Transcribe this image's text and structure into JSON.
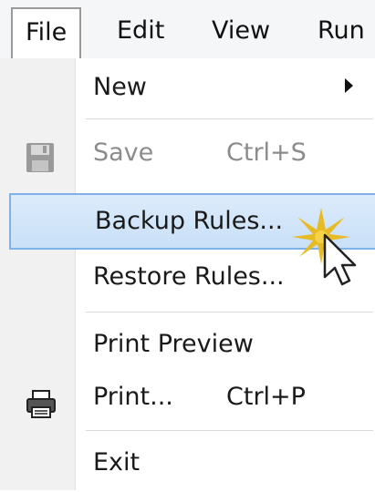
{
  "menubar": {
    "items": [
      {
        "label": "File"
      },
      {
        "label": "Edit"
      },
      {
        "label": "View"
      },
      {
        "label": "Run"
      }
    ]
  },
  "menu": {
    "items": [
      {
        "label": "New",
        "shortcut": "",
        "has_submenu": true
      },
      {
        "label": "Save",
        "shortcut": "Ctrl+S",
        "disabled": true,
        "icon": "floppy-disk-icon"
      },
      {
        "label": "Backup Rules...",
        "shortcut": "",
        "highlighted": true
      },
      {
        "label": "Restore Rules...",
        "shortcut": ""
      },
      {
        "label": "Print Preview",
        "shortcut": ""
      },
      {
        "label": "Print...",
        "shortcut": "Ctrl+P",
        "icon": "printer-icon"
      },
      {
        "label": "Exit",
        "shortcut": ""
      }
    ]
  },
  "colors": {
    "highlight_fill": "#c9e0f7",
    "highlight_border": "#7fb2e8",
    "click_burst": "#e8b81a"
  }
}
